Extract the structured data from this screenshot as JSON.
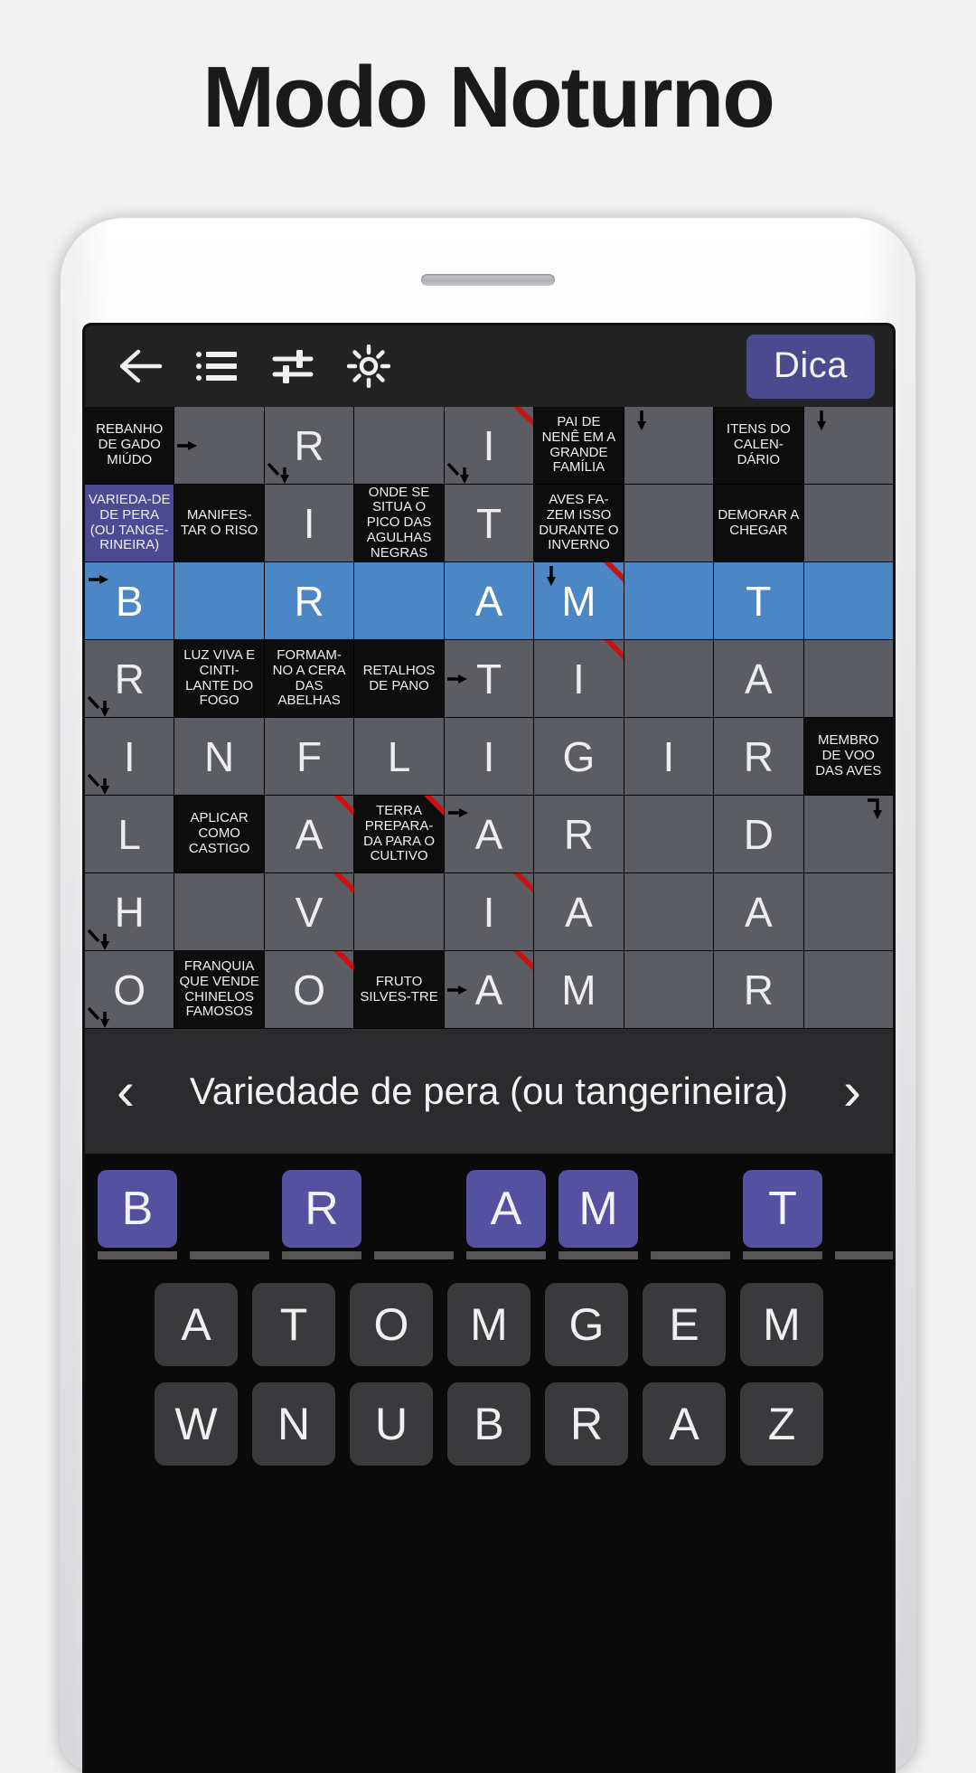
{
  "headline": "Modo Noturno",
  "colors": {
    "accent_purple": "#4b4a8e",
    "tile_purple": "#5550a0",
    "highlight_blue": "#4a87c4",
    "cell_gray": "#5c5c63",
    "clue_black": "#0d0d0d",
    "key_gray": "#3a3a3c",
    "marker_red": "#cc1111"
  },
  "toolbar": {
    "back_icon": "back-arrow-icon",
    "list_icon": "list-icon",
    "tune_icon": "tune-sliders-icon",
    "brightness_icon": "brightness-sun-icon",
    "hint_label": "Dica"
  },
  "grid": {
    "columns": 9,
    "rows": [
      [
        {
          "type": "clue",
          "text": "REBANHO DE GADO MIÚDO"
        },
        {
          "type": "letter",
          "text": "",
          "arrow": "right"
        },
        {
          "type": "letter",
          "text": "R",
          "arrow": "diag-down"
        },
        {
          "type": "letter",
          "text": ""
        },
        {
          "type": "letter",
          "text": "I",
          "arrow": "diag-down",
          "red": true
        },
        {
          "type": "clue",
          "text": "PAI DE NENÊ EM A GRANDE FAMÍLIA"
        },
        {
          "type": "letter",
          "text": "",
          "arrow": "down"
        },
        {
          "type": "clue",
          "text": "ITENS DO CALEN-DÁRIO"
        },
        {
          "type": "letter",
          "text": "",
          "arrow": "down"
        }
      ],
      [
        {
          "type": "clue",
          "text": "VARIEDA-DE DE PERA (OU TANGE-RINEIRA)",
          "hl": true
        },
        {
          "type": "clue",
          "text": "MANIFES-TAR O RISO"
        },
        {
          "type": "letter",
          "text": "I"
        },
        {
          "type": "clue",
          "text": "ONDE SE SITUA O PICO DAS AGULHAS NEGRAS"
        },
        {
          "type": "letter",
          "text": "T"
        },
        {
          "type": "clue",
          "text": "AVES FA-ZEM ISSO DURANTE O INVERNO"
        },
        {
          "type": "letter",
          "text": ""
        },
        {
          "type": "clue",
          "text": "DEMORAR A CHEGAR"
        },
        {
          "type": "letter",
          "text": ""
        }
      ],
      [
        {
          "type": "letter",
          "text": "B",
          "hl": true,
          "arrow": "right-top"
        },
        {
          "type": "letter",
          "text": "",
          "hl": true
        },
        {
          "type": "letter",
          "text": "R",
          "hl": true
        },
        {
          "type": "letter",
          "text": "",
          "hl": true
        },
        {
          "type": "letter",
          "text": "A",
          "hl": true
        },
        {
          "type": "letter",
          "text": "M",
          "hl": true,
          "red": true,
          "arrow": "down"
        },
        {
          "type": "letter",
          "text": "",
          "hl": true
        },
        {
          "type": "letter",
          "text": "T",
          "hl": true
        },
        {
          "type": "letter",
          "text": "",
          "hl": true
        }
      ],
      [
        {
          "type": "letter",
          "text": "R",
          "arrow": "diag-down"
        },
        {
          "type": "clue",
          "text": "LUZ VIVA E CINTI-LANTE DO FOGO"
        },
        {
          "type": "clue",
          "text": "FORMAM-NO A CERA DAS ABELHAS"
        },
        {
          "type": "clue",
          "text": "RETALHOS DE PANO"
        },
        {
          "type": "letter",
          "text": "T",
          "arrow": "right"
        },
        {
          "type": "letter",
          "text": "I",
          "red": true
        },
        {
          "type": "letter",
          "text": ""
        },
        {
          "type": "letter",
          "text": "A"
        },
        {
          "type": "letter",
          "text": ""
        }
      ],
      [
        {
          "type": "letter",
          "text": "I",
          "arrow": "diag-down"
        },
        {
          "type": "letter",
          "text": "N"
        },
        {
          "type": "letter",
          "text": "F"
        },
        {
          "type": "letter",
          "text": "L"
        },
        {
          "type": "letter",
          "text": "I"
        },
        {
          "type": "letter",
          "text": "G"
        },
        {
          "type": "letter",
          "text": "I"
        },
        {
          "type": "letter",
          "text": "R"
        },
        {
          "type": "clue",
          "text": "MEMBRO DE VOO DAS AVES"
        }
      ],
      [
        {
          "type": "letter",
          "text": "L"
        },
        {
          "type": "clue",
          "text": "APLICAR COMO CASTIGO"
        },
        {
          "type": "letter",
          "text": "A",
          "red": true
        },
        {
          "type": "clue",
          "text": "TERRA PREPARA-DA PARA O CULTIVO",
          "red": true
        },
        {
          "type": "letter",
          "text": "A",
          "arrow": "right-top"
        },
        {
          "type": "letter",
          "text": "R"
        },
        {
          "type": "letter",
          "text": ""
        },
        {
          "type": "letter",
          "text": "D"
        },
        {
          "type": "letter",
          "text": "",
          "arrow": "down-right"
        }
      ],
      [
        {
          "type": "letter",
          "text": "H",
          "arrow": "diag-down"
        },
        {
          "type": "letter",
          "text": ""
        },
        {
          "type": "letter",
          "text": "V",
          "red": true
        },
        {
          "type": "letter",
          "text": ""
        },
        {
          "type": "letter",
          "text": "I",
          "red": true
        },
        {
          "type": "letter",
          "text": "A"
        },
        {
          "type": "letter",
          "text": ""
        },
        {
          "type": "letter",
          "text": "A"
        },
        {
          "type": "letter",
          "text": ""
        }
      ],
      [
        {
          "type": "letter",
          "text": "O",
          "arrow": "diag-down"
        },
        {
          "type": "clue",
          "text": "FRANQUIA QUE VENDE CHINELOS FAMOSOS"
        },
        {
          "type": "letter",
          "text": "O",
          "red": true
        },
        {
          "type": "clue",
          "text": "FRUTO SILVES-TRE"
        },
        {
          "type": "letter",
          "text": "A",
          "arrow": "right",
          "red": true
        },
        {
          "type": "letter",
          "text": "M"
        },
        {
          "type": "letter",
          "text": ""
        },
        {
          "type": "letter",
          "text": "R"
        },
        {
          "type": "letter",
          "text": ""
        }
      ]
    ]
  },
  "clue_bar": {
    "prev_label": "‹",
    "next_label": "›",
    "text": "Variedade de pera (ou tangerineira)"
  },
  "answer": {
    "slots": [
      {
        "letter": "B",
        "filled": true
      },
      {
        "letter": "",
        "filled": false
      },
      {
        "letter": "R",
        "filled": true
      },
      {
        "letter": "",
        "filled": false
      },
      {
        "letter": "A",
        "filled": true
      },
      {
        "letter": "M",
        "filled": true
      },
      {
        "letter": "",
        "filled": false
      },
      {
        "letter": "T",
        "filled": true
      },
      {
        "letter": "",
        "filled": false
      }
    ]
  },
  "keyboard": {
    "rows": [
      [
        "A",
        "T",
        "O",
        "M",
        "G",
        "E",
        "M"
      ],
      [
        "W",
        "N",
        "U",
        "B",
        "R",
        "A",
        "Z"
      ]
    ]
  }
}
